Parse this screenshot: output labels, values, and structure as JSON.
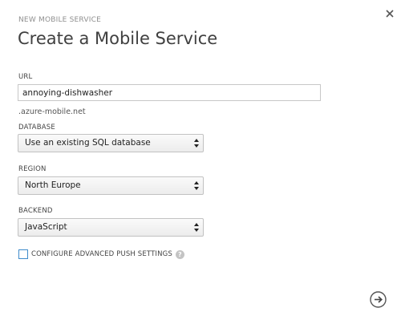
{
  "dialog": {
    "subtitle": "NEW MOBILE SERVICE",
    "title": "Create a Mobile Service",
    "close_icon": "close-icon",
    "next_icon": "arrow-right-circle-icon"
  },
  "url": {
    "label": "URL",
    "value": "annoying-dishwasher",
    "suffix": ".azure-mobile.net"
  },
  "database": {
    "label": "DATABASE",
    "selected": "Use an existing SQL database"
  },
  "region": {
    "label": "REGION",
    "selected": "North Europe"
  },
  "backend": {
    "label": "BACKEND",
    "selected": "JavaScript"
  },
  "push_settings": {
    "label": "CONFIGURE ADVANCED PUSH SETTINGS",
    "checked": false,
    "help_icon": "question-mark-icon",
    "help_glyph": "?"
  },
  "colors": {
    "accent": "#3f8ccb",
    "title": "#404040",
    "subtitle": "#8f8f8f"
  }
}
